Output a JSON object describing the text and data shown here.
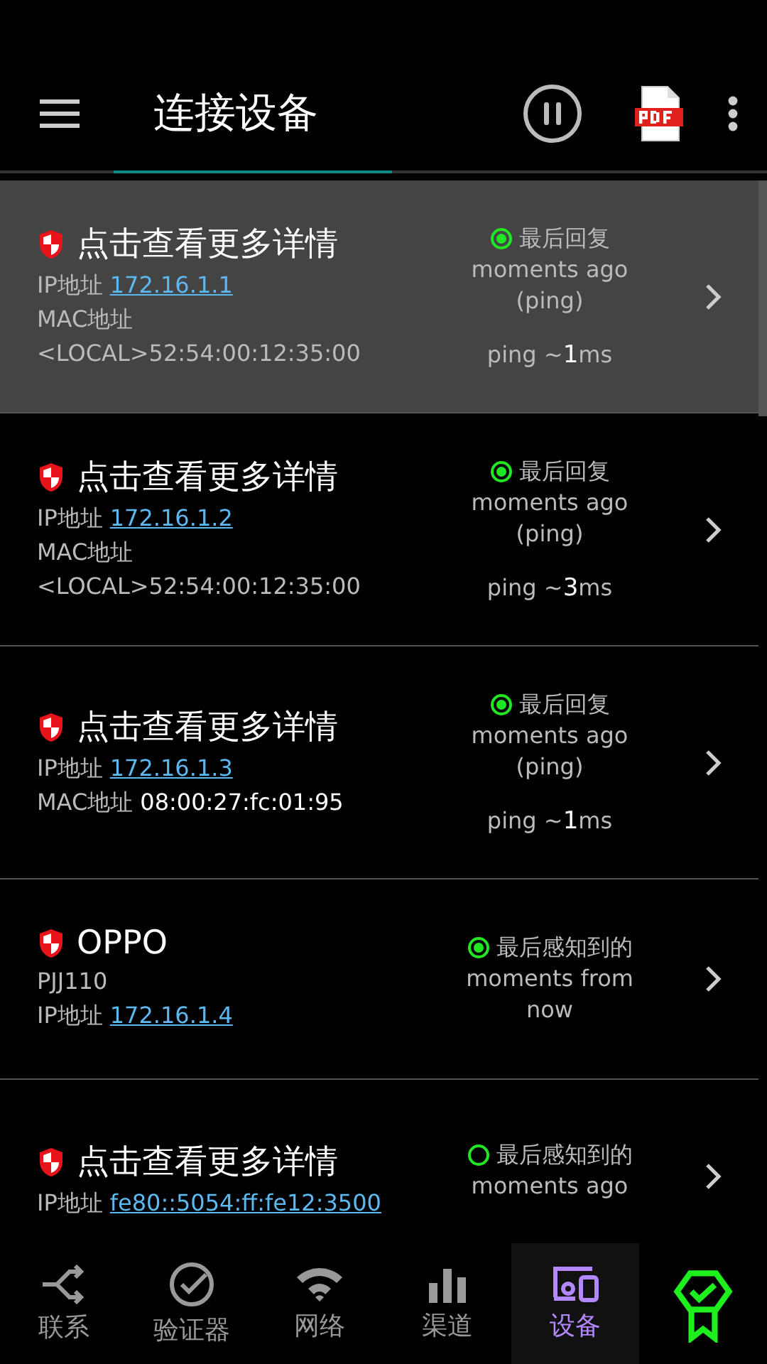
{
  "app_bar": {
    "title": "连接设备"
  },
  "devices": [
    {
      "name": "点击查看更多详情",
      "selected": true,
      "lines": [
        {
          "label": "IP地址",
          "value": "172.16.1.1",
          "kind": "link"
        },
        {
          "label": "MAC地址"
        },
        {
          "value": "<LOCAL>52:54:00:12:35:00",
          "kind": "text"
        }
      ],
      "status": {
        "online": true,
        "title": "最后回复",
        "lines": [
          "moments ago",
          "(ping)"
        ],
        "ping": "ping ~**1**ms"
      }
    },
    {
      "name": "点击查看更多详情",
      "selected": false,
      "lines": [
        {
          "label": "IP地址",
          "value": "172.16.1.2",
          "kind": "link"
        },
        {
          "label": "MAC地址"
        },
        {
          "value": "<LOCAL>52:54:00:12:35:00",
          "kind": "text"
        }
      ],
      "status": {
        "online": true,
        "title": "最后回复",
        "lines": [
          "moments ago",
          "(ping)"
        ],
        "ping": "ping ~**3**ms"
      }
    },
    {
      "name": "点击查看更多详情",
      "selected": false,
      "lines": [
        {
          "label": "IP地址",
          "value": "172.16.1.3",
          "kind": "link"
        },
        {
          "label": "MAC地址",
          "value": "08:00:27:fc:01:95",
          "kind": "text"
        }
      ],
      "status": {
        "online": true,
        "title": "最后回复",
        "lines": [
          "moments ago",
          "(ping)"
        ],
        "ping": "ping ~**1**ms"
      }
    },
    {
      "name": "OPPO",
      "selected": false,
      "lines": [
        {
          "value": "PJJ110",
          "kind": "text"
        },
        {
          "label": "IP地址",
          "value": "172.16.1.4",
          "kind": "link"
        }
      ],
      "status": {
        "online": true,
        "title": "最后感知到的",
        "lines": [
          "moments from",
          "now"
        ]
      }
    },
    {
      "name": "点击查看更多详情",
      "selected": false,
      "lines": [
        {
          "label": "IP地址",
          "value": "fe80::5054:ff:fe12:3500",
          "kind": "link"
        }
      ],
      "status": {
        "online": false,
        "title": "最后感知到的",
        "lines": [
          "moments ago"
        ]
      }
    }
  ],
  "bottom_nav": [
    {
      "label": "联系",
      "kind": "share",
      "selected": false
    },
    {
      "label": "验证器",
      "kind": "check",
      "selected": false
    },
    {
      "label": "网络",
      "kind": "wifi",
      "selected": false
    },
    {
      "label": "渠道",
      "kind": "bars",
      "selected": false
    },
    {
      "label": "设备",
      "kind": "devices",
      "selected": true
    },
    {
      "kind": "badge",
      "selected": false
    }
  ]
}
